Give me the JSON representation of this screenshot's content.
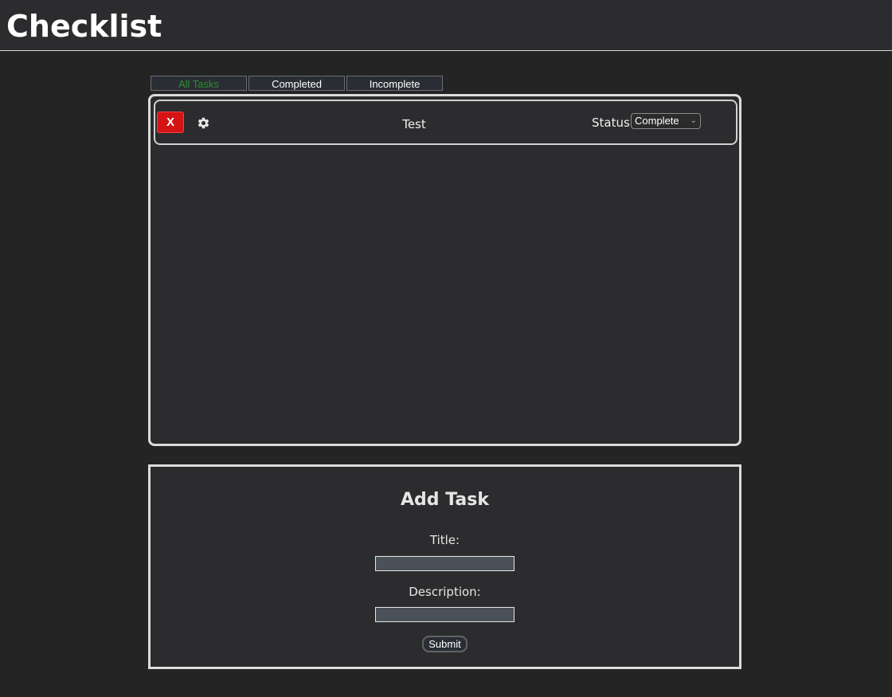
{
  "header": {
    "title": "Checklist"
  },
  "tabs": [
    {
      "label": "All Tasks",
      "active": true
    },
    {
      "label": "Completed",
      "active": false
    },
    {
      "label": "Incomplete",
      "active": false
    }
  ],
  "tasks": [
    {
      "delete_label": "X",
      "settings_icon": "gear-icon",
      "title": "Test",
      "status_label": "Status:",
      "status_value": "Complete"
    }
  ],
  "add_task": {
    "heading": "Add Task",
    "title_label": "Title:",
    "title_value": "",
    "description_label": "Description:",
    "description_value": "",
    "submit_label": "Submit"
  },
  "colors": {
    "background": "#242424",
    "panel": "#2c2c2e",
    "active_tab_text": "#2f8f2f",
    "delete_button": "#d41414",
    "input_background": "#4a5159"
  }
}
